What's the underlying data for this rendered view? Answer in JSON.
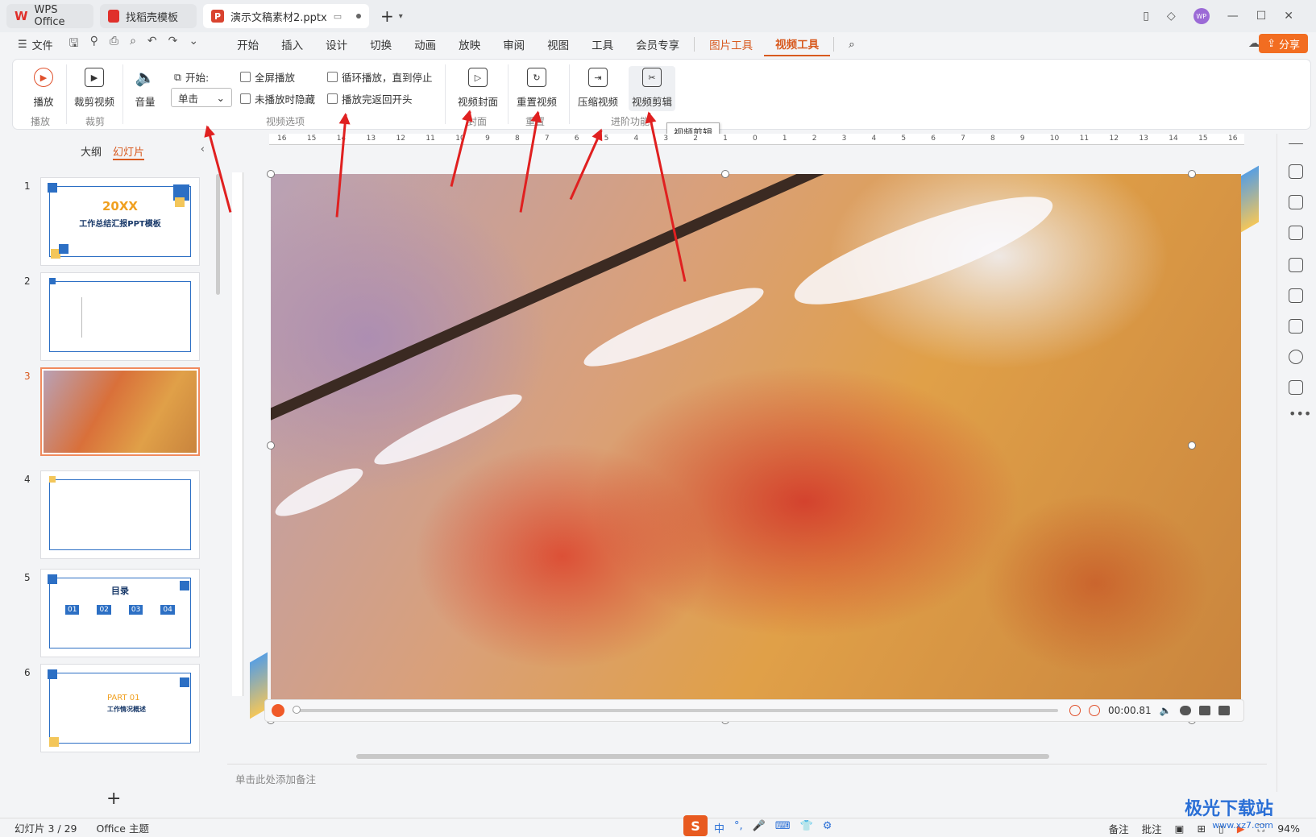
{
  "titlebar": {
    "tabs": [
      {
        "label": "WPS Office"
      },
      {
        "label": "找稻壳模板"
      },
      {
        "label": "演示文稿素材2.pptx"
      }
    ],
    "avatar_text": "WP"
  },
  "menubar": {
    "file": "文件",
    "items": [
      "开始",
      "插入",
      "设计",
      "切换",
      "动画",
      "放映",
      "审阅",
      "视图",
      "工具",
      "会员专享"
    ],
    "context_items": [
      "图片工具",
      "视频工具"
    ],
    "share": "分享"
  },
  "ribbon": {
    "play": "播放",
    "crop_video": "裁剪视频",
    "volume": "音量",
    "start_label": "开始:",
    "start_value": "单击",
    "fullscreen": "全屏播放",
    "hide_when_not_playing": "未播放时隐藏",
    "loop": "循环播放，直到停止",
    "rewind": "播放完返回开头",
    "video_cover": "视频封面",
    "reset_video": "重置视频",
    "compress_video": "压缩视频",
    "video_edit": "视频剪辑",
    "groups": {
      "play": "播放",
      "crop": "裁剪",
      "options": "视频选项",
      "cover": "封面",
      "reset": "重置",
      "advanced": "进阶功能"
    },
    "tooltip": "视频剪辑"
  },
  "slidepanel": {
    "tab_outline": "大纲",
    "tab_slides": "幻灯片",
    "slides": [
      {
        "num": "1",
        "title": "20XX",
        "subtitle": "工作总结汇报PPT模板"
      },
      {
        "num": "2"
      },
      {
        "num": "3"
      },
      {
        "num": "4"
      },
      {
        "num": "5",
        "title": "目录",
        "items": [
          "01",
          "02",
          "03",
          "04"
        ]
      },
      {
        "num": "6",
        "title": "PART 01",
        "subtitle": "工作情况概述"
      }
    ],
    "add": "+"
  },
  "ruler": {
    "labels": [
      "16",
      "15",
      "14",
      "13",
      "12",
      "11",
      "10",
      "9",
      "8",
      "7",
      "6",
      "5",
      "4",
      "3",
      "2",
      "1",
      "0",
      "1",
      "2",
      "3",
      "4",
      "5",
      "6",
      "7",
      "8",
      "9",
      "10",
      "11",
      "12",
      "13",
      "14",
      "15",
      "16"
    ]
  },
  "player": {
    "time": "00:00.81"
  },
  "notes": {
    "placeholder": "单击此处添加备注"
  },
  "statusbar": {
    "slide": "幻灯片 3 / 29",
    "theme": "Office 主题",
    "notes_label": "备注",
    "comments": "批注",
    "zoom": "94%"
  },
  "ime": {
    "logo": "S",
    "lang": "中"
  },
  "watermark": {
    "title": "极光下载站",
    "url": "www.xz7.com"
  },
  "colors": {
    "accent": "#d85a1f",
    "annotation_arrow": "#e02020"
  }
}
